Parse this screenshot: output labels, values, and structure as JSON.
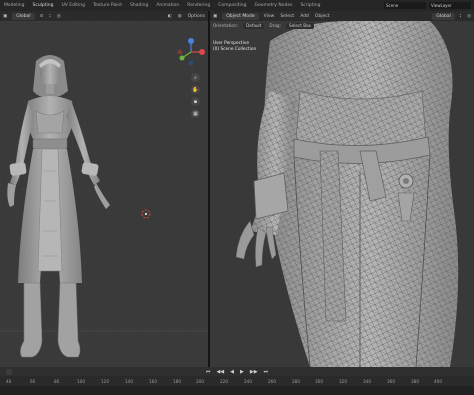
{
  "topbar": {
    "tabs": [
      "Modeling",
      "Sculpting",
      "UV Editing",
      "Texture Paint",
      "Shading",
      "Animation",
      "Rendering",
      "Compositing",
      "Geometry Nodes",
      "Scripting"
    ],
    "active_tab": "Sculpting",
    "scene_label": "Scene",
    "view_layer_label": "ViewLayer"
  },
  "left_view": {
    "view_dropdown": "Global",
    "options_label": "Options"
  },
  "right_view": {
    "mode_dropdown": "Object Mode",
    "menu": [
      "View",
      "Select",
      "Add",
      "Object"
    ],
    "global_dropdown": "Global",
    "orientation_label": "Orientation:",
    "orientation_value": "Default",
    "drag_label": "Drag:",
    "drag_value": "Select Box",
    "overlay_line1": "User Perspective",
    "overlay_line2": "(0) Scene Collection"
  },
  "timeline": {
    "ruler_ticks": [
      "40",
      "60",
      "80",
      "100",
      "120",
      "140",
      "160",
      "180",
      "200",
      "220",
      "240",
      "260",
      "280",
      "300",
      "320",
      "340",
      "360",
      "380",
      "400"
    ],
    "controls": [
      "⏮",
      "◀◀",
      "◀",
      "▶",
      "▶▶",
      "⏭"
    ]
  },
  "colors": {
    "viewport_bg": "#3a3a3a",
    "model_fill": "#9a9a9a",
    "wire": "#5a5a5a",
    "axis_x": "#e04848",
    "axis_y": "#6fb43a",
    "axis_z": "#4a82e0"
  }
}
